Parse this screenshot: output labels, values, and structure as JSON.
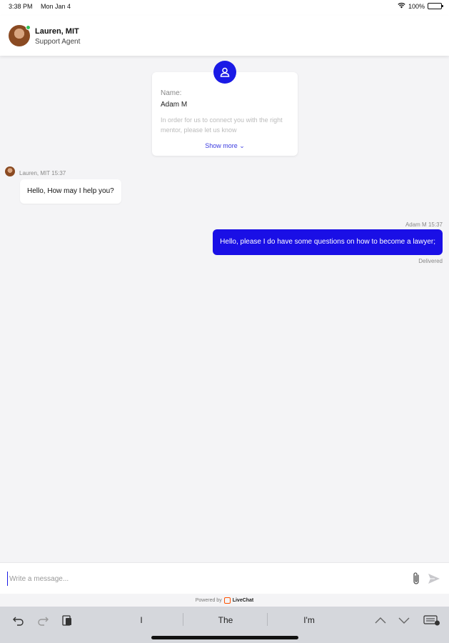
{
  "status_bar": {
    "time": "3:38 PM",
    "date": "Mon Jan 4",
    "battery": "100%"
  },
  "header": {
    "agent_name": "Lauren, MIT",
    "agent_role": "Support Agent"
  },
  "form_card": {
    "label": "Name:",
    "value": "Adam M",
    "description": "In order for us to connect you with the right mentor, please let us know",
    "show_more": "Show more ⌄"
  },
  "messages": [
    {
      "sender": "Lauren, MIT",
      "time": "15:37",
      "text": "Hello, How may I help you?"
    },
    {
      "sender": "Adam M",
      "time": "15:37",
      "text": "Hello, please I do have some questions on how to become a lawyer;",
      "status": "Delivered"
    }
  ],
  "composer": {
    "placeholder": "Write a message...",
    "value": ""
  },
  "footer": {
    "powered_by": "Powered by",
    "brand": "LiveChat"
  },
  "keyboard": {
    "suggestions": [
      "I",
      "The",
      "I'm"
    ]
  },
  "colors": {
    "accent": "#1a0fe6",
    "online": "#2fbf55",
    "brand": "#ff5100"
  }
}
